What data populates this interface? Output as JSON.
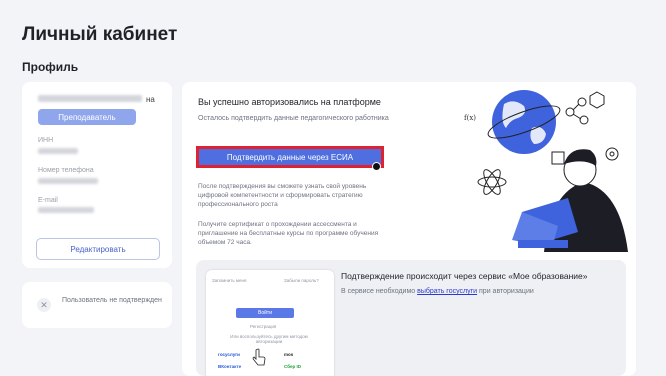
{
  "page": {
    "title": "Личный кабинет",
    "section_title": "Профиль"
  },
  "profile": {
    "name_suffix": "на",
    "role_badge": "Преподаватель",
    "fields": [
      {
        "label": "ИНН"
      },
      {
        "label": "Номер телефона"
      },
      {
        "label": "E-mail"
      }
    ],
    "edit_button": "Редактировать"
  },
  "user_status": {
    "icon": "close-icon",
    "text": "Пользователь не подтвержден"
  },
  "main": {
    "title": "Вы успешно авторизовались на платформе",
    "subtitle": "Осталось подтвердить данные педагогического работника",
    "confirm_button": "Подтвердить данные через ЕСИА",
    "info1": "После подтверждения вы сможете узнать свой уровень цифровой компетентности и сформировать стратегию профессионального роста",
    "info2": "Получите сертификат о прохождении ассессмента и приглашение на бесплатные курсы по программе обучения объемом 72 часа."
  },
  "service": {
    "title": "Подтверждение происходит через сервис «Мое образование»",
    "text_prefix": "В сервисе необходимо ",
    "link": "выбрать госуслуги",
    "text_suffix": " при авторизации",
    "phone": {
      "remember": "Запомнить меня",
      "forgot": "Забыли пароль?",
      "login_button": "Войти",
      "register": "Регистрация",
      "alt_login": "Или воспользуйтесь другим методом авторизации",
      "logo_gosuslugi": "госуслуги",
      "logo_mos": "mos",
      "logo_vk": "ВКонтакте",
      "logo_sber": "Сбер ID"
    }
  },
  "colors": {
    "accent": "#4f6fe0",
    "highlight": "#e0212f",
    "badge": "#8fa6ec"
  }
}
